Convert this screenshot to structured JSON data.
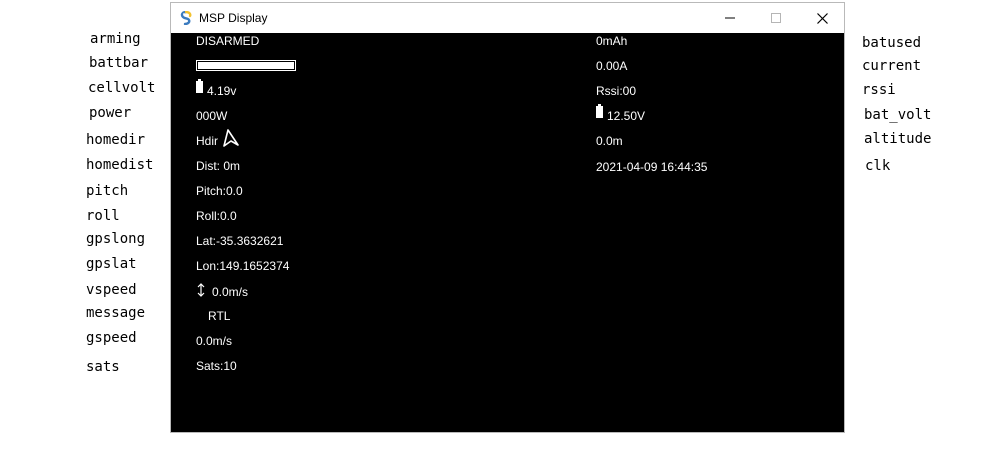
{
  "left_labels": {
    "arming": "arming",
    "battbar": "battbar",
    "cellvolt": "cellvolt",
    "power": "power",
    "homedir": "homedir",
    "homedist": "homedist",
    "pitch": "pitch",
    "roll": "roll",
    "gpslong": "gpslong",
    "gpslat": "gpslat",
    "vspeed": "vspeed",
    "message": "message",
    "gspeed": "gspeed",
    "sats": "sats"
  },
  "right_labels": {
    "batused": "batused",
    "current": "current",
    "rssi": "rssi",
    "bat_volt": "bat_volt",
    "altitude": "altitude",
    "clk": "clk"
  },
  "window": {
    "title": "MSP Display",
    "icon": "pygame-snake-icon",
    "controls": {
      "minimize_icon": "minimize-icon",
      "maximize_icon": "maximize-icon",
      "close_icon": "close-icon"
    }
  },
  "osd": {
    "arming": "DISARMED",
    "battbar_fill": 1.0,
    "cellvolt": "4.19v",
    "power": "000W",
    "homedir": "Hdir",
    "homedist": "Dist: 0m",
    "pitch": "Pitch:0.0",
    "roll": "Roll:0.0",
    "gpslat": "Lat:-35.3632621",
    "gpslong": "Lon:149.1652374",
    "vspeed": "0.0m/s",
    "message": "RTL",
    "gspeed": "0.0m/s",
    "sats": "Sats:10",
    "batused": "0mAh",
    "current": "0.00A",
    "rssi": "Rssi:00",
    "bat_volt": "12.50V",
    "altitude": "0.0m",
    "clk": "2021-04-09 16:44:35"
  },
  "colors": {
    "osd_background": "#000000",
    "osd_text": "#ffffff",
    "titlebar": "#ffffff"
  }
}
